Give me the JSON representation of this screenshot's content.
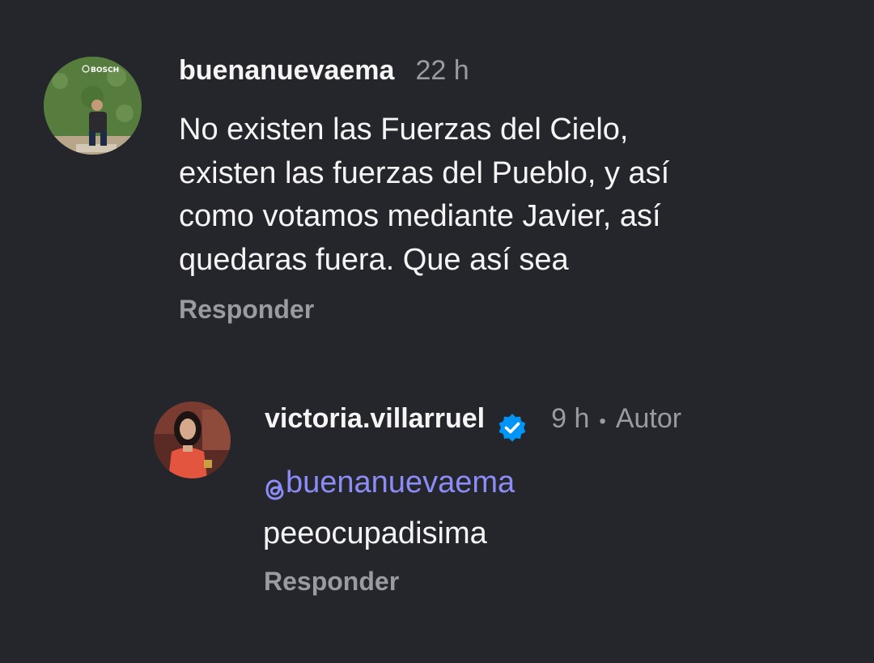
{
  "comment": {
    "username": "buenanuevaema",
    "time": "22 h",
    "lines": [
      "No existen las Fuerzas del Cielo,",
      "existen las fuerzas del Pueblo, y así",
      "como votamos mediante Javier, así",
      "quedaras fuera. Que así sea"
    ],
    "reply_label": "Responder",
    "avatar_logo_text": "BOSCH"
  },
  "reply": {
    "username": "victoria.villarruel",
    "time": "9 h",
    "separator": "•",
    "author_label": "Autor",
    "mention": "@buenanuevaema",
    "text": "peeocupadisima",
    "reply_label": "Responder"
  },
  "colors": {
    "background": "#25262c",
    "text": "#f5f5f5",
    "muted": "#9a9ba1",
    "mention": "#8c8cf6",
    "verified": "#0095f6"
  },
  "icons": [
    "verified-badge-icon",
    "threads-icon"
  ]
}
